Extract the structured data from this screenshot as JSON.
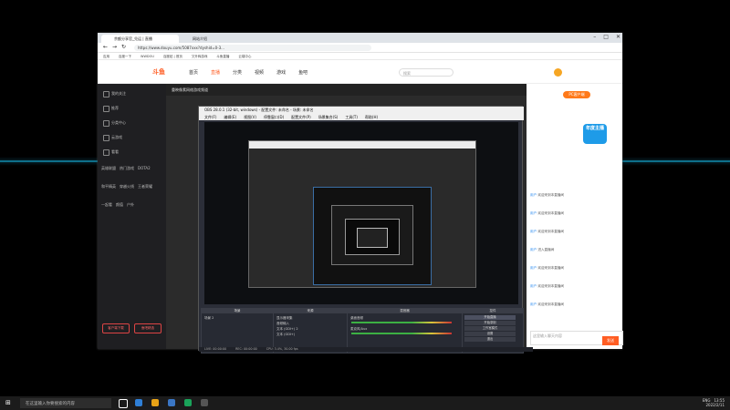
{
  "browser": {
    "tabs": [
      {
        "label": "余额分享官_兑运 | 直播",
        "active": true
      },
      {
        "label": "网站介绍",
        "active": false
      }
    ],
    "url": "https://www.douyu.com/5087xxx?dyshid=0-3...",
    "bookmarks": [
      "应用",
      "百度一下",
      "WWDOU",
      "百度贴 | 首页",
      "又升辉游戏",
      "斗鱼直播",
      "云端中心"
    ]
  },
  "site": {
    "logo": "斗鱼",
    "nav": [
      "首页",
      "直播",
      "分类",
      "视频",
      "游戏",
      "鱼吧"
    ],
    "search_placeholder": "搜索",
    "sidebar": {
      "top_items": [
        "我的关注",
        "推荐",
        "分类中心",
        "云游戏",
        "看看"
      ],
      "sections": [
        [
          "英雄联盟",
          "热门游戏",
          "DOTA2"
        ],
        [
          "和平精英",
          "穿越火线",
          "王者荣耀"
        ],
        [
          "一起看",
          "颜值",
          "户外"
        ]
      ],
      "buttons": [
        "客户端下载",
        "鱼吧精选"
      ]
    },
    "stream_title": "重映像素网络游戏频道"
  },
  "danmu": {
    "pc_button": "PC客户端",
    "gift_badge": "年度主播",
    "lines": [
      {
        "user": "用户",
        "text": "欢迎来到本直播间"
      },
      {
        "user": "用户",
        "text": "欢迎来到本直播间"
      },
      {
        "user": "用户",
        "text": "欢迎来到本直播间"
      },
      {
        "user": "用户",
        "text": "进入直播间"
      },
      {
        "user": "用户",
        "text": "欢迎来到本直播间"
      },
      {
        "user": "用户",
        "text": "欢迎来到本直播间"
      },
      {
        "user": "用户",
        "text": "欢迎来到本直播间"
      }
    ],
    "input_placeholder": "这里输入聊天内容",
    "send_label": "发送"
  },
  "obs": {
    "title": "OBS 28.0.1 (32-bit, windows) - 配置文件: 未命名 - 场景: 未命名",
    "menu": [
      "文件(F)",
      "编辑(E)",
      "视图(V)",
      "停靠窗口(D)",
      "配置文件(P)",
      "场景集合(S)",
      "工具(T)",
      "帮助(H)"
    ],
    "docks": {
      "scenes": {
        "title": "场景",
        "items": [
          "场景 2"
        ]
      },
      "sources": {
        "title": "来源",
        "items": [
          "显示器采集",
          "音频输入",
          "文本 (GDI+) 2",
          "文本 (GDI+)"
        ]
      },
      "mixer": {
        "title": "混音器",
        "items": [
          "桌面音频",
          "麦克风/Aux"
        ]
      },
      "controls": {
        "title": "控件",
        "buttons": [
          "开始直播",
          "开始录制",
          "工作室模式",
          "设置",
          "退出"
        ]
      }
    },
    "status": [
      "LIVE: 00:00:00",
      "REC: 00:00:00",
      "CPU: 3.4%, 30.00 fps"
    ]
  },
  "taskbar": {
    "search_placeholder": "在这里输入你要搜索的内容",
    "time": "13:55",
    "date": "2022/2/11",
    "lang": "ENG"
  }
}
